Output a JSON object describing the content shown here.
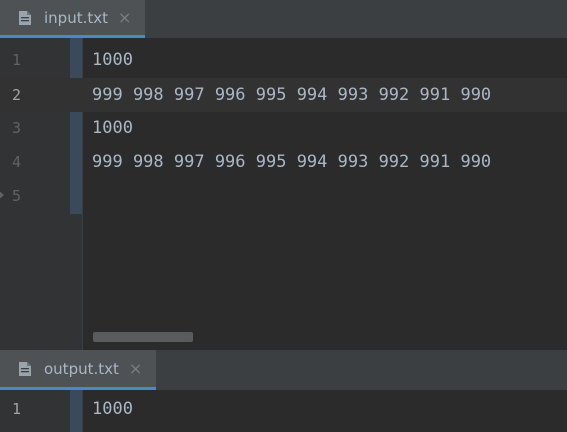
{
  "colors": {
    "background": "#2b2b2b",
    "gutter": "#313335",
    "tab_active_underline": "#4a88c7",
    "text": "#a9b7c6",
    "line_number": "#606366"
  },
  "top_editor": {
    "tab": {
      "label": "input.txt",
      "icon": "text-file-icon",
      "close": "×"
    },
    "lines": [
      {
        "number": "1",
        "text": "1000"
      },
      {
        "number": "2",
        "text": "999 998 997 996 995 994 993 992 991 990"
      },
      {
        "number": "3",
        "text": "1000"
      },
      {
        "number": "4",
        "text": "999 998 997 996 995 994 993 992 991 990"
      },
      {
        "number": "5",
        "text": ""
      }
    ],
    "current_line": 2
  },
  "bottom_editor": {
    "tab": {
      "label": "output.txt",
      "icon": "text-file-icon",
      "close": "×"
    },
    "lines": [
      {
        "number": "1",
        "text": "1000"
      }
    ]
  }
}
